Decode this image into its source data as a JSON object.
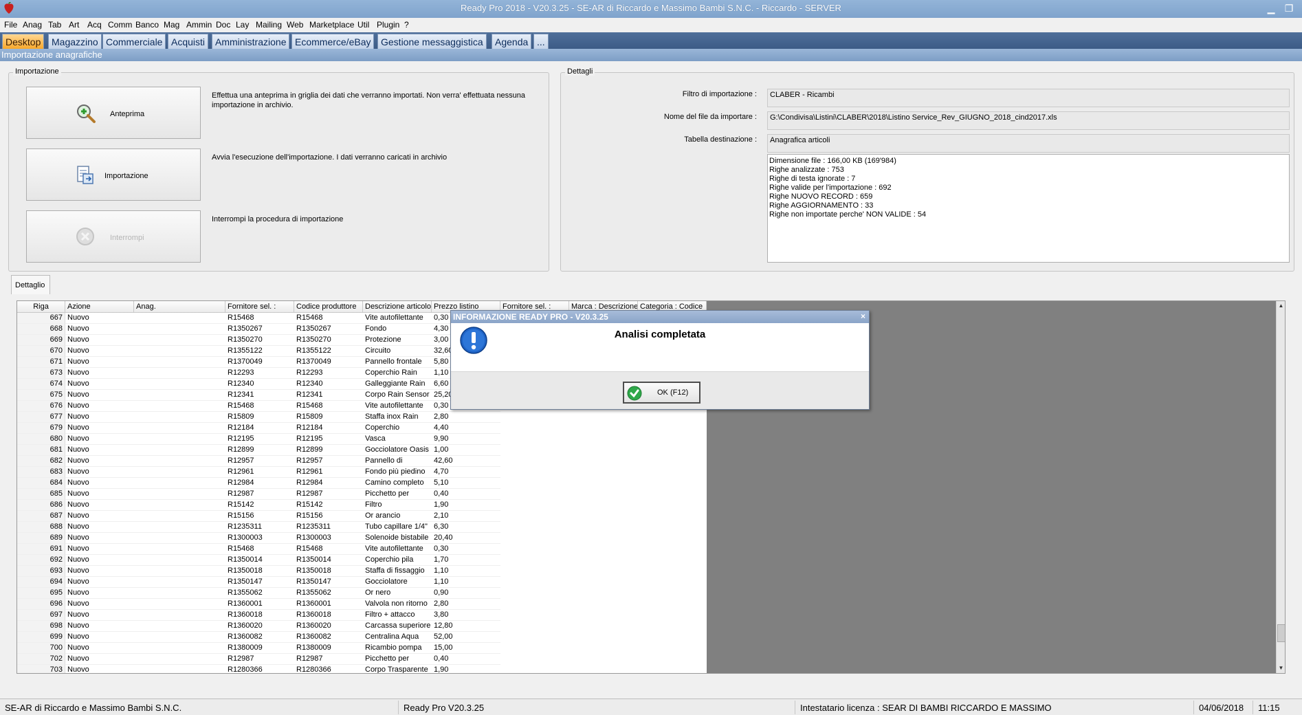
{
  "window": {
    "title": "Ready Pro 2018 - V20.3.25 - SE-AR di Riccardo e Massimo Bambi S.N.C. - Riccardo - SERVER"
  },
  "menu": [
    "File",
    "Anag",
    "Tab",
    "Art",
    "Acq",
    "Comm",
    "Banco",
    "Mag",
    "Ammin",
    "Doc",
    "Lay",
    "Mailing",
    "Web",
    "Marketplace",
    "Util",
    "Plugin",
    "?"
  ],
  "module_tabs": [
    "Desktop",
    "Magazzino",
    "Commerciale",
    "Acquisti",
    "Amministrazione",
    "Ecommerce/eBay",
    "Gestione messaggistica",
    "Agenda",
    "..."
  ],
  "section_header": "Importazione anagrafiche",
  "importazione": {
    "group_title": "Importazione",
    "anteprima_label": "Anteprima",
    "anteprima_desc": "Effettua una anteprima in griglia dei dati che verranno importati. Non verra' effettuata nessuna importazione in archivio.",
    "importazione_label": "Importazione",
    "importazione_desc": "Avvia l'esecuzione dell'importazione. I dati verranno caricati in archivio",
    "interrompi_label": "Interrompi",
    "interrompi_desc": "Interrompi la procedura di importazione"
  },
  "dettagli": {
    "group_title": "Dettagli",
    "filtro_label": "Filtro di importazione :",
    "filtro_value": "CLABER - Ricambi",
    "file_label": "Nome del file da importare :",
    "file_value": "G:\\Condivisa\\Listini\\CLABER\\2018\\Listino Service_Rev_GIUGNO_2018_cind2017.xls",
    "tabella_label": "Tabella destinazione :",
    "tabella_value": "Anagrafica articoli",
    "info_lines": [
      "Dimensione file : 166,00 KB (169'984)",
      "Righe analizzate : 753",
      "Righe di testa ignorate : 7",
      "Righe valide per l'importazione : 692",
      "Righe NUOVO RECORD : 659",
      "Righe AGGIORNAMENTO  : 33",
      "Righe non importate perche' NON VALIDE : 54"
    ]
  },
  "detail_tab": "Dettaglio",
  "grid": {
    "columns": [
      "Riga",
      "Azione",
      "Anag.",
      "Fornitore sel. :",
      "Codice produttore",
      "Descrizione articolo",
      "Prezzo listino",
      "Fornitore sel. :",
      "Marca : Descrizione",
      "Categoria : Codice"
    ],
    "rows": [
      [
        "667",
        "Nuovo",
        "",
        "R15468",
        "R15468",
        "Vite autofilettante",
        "0,30"
      ],
      [
        "668",
        "Nuovo",
        "",
        "R1350267",
        "R1350267",
        "Fondo",
        "4,30"
      ],
      [
        "669",
        "Nuovo",
        "",
        "R1350270",
        "R1350270",
        "Protezione",
        "3,00"
      ],
      [
        "670",
        "Nuovo",
        "",
        "R1355122",
        "R1355122",
        "Circuito",
        "32,60"
      ],
      [
        "671",
        "Nuovo",
        "",
        "R1370049",
        "R1370049",
        "Pannello frontale",
        "5,80"
      ],
      [
        "673",
        "Nuovo",
        "",
        "R12293",
        "R12293",
        "Coperchio Rain",
        "1,10"
      ],
      [
        "674",
        "Nuovo",
        "",
        "R12340",
        "R12340",
        "Galleggiante Rain",
        "6,60"
      ],
      [
        "675",
        "Nuovo",
        "",
        "R12341",
        "R12341",
        "Corpo Rain Sensor",
        "25,20"
      ],
      [
        "676",
        "Nuovo",
        "",
        "R15468",
        "R15468",
        "Vite autofilettante",
        "0,30"
      ],
      [
        "677",
        "Nuovo",
        "",
        "R15809",
        "R15809",
        "Staffa inox Rain",
        "2,80"
      ],
      [
        "679",
        "Nuovo",
        "",
        "R12184",
        "R12184",
        "Coperchio",
        "4,40"
      ],
      [
        "680",
        "Nuovo",
        "",
        "R12195",
        "R12195",
        "Vasca",
        "9,90"
      ],
      [
        "681",
        "Nuovo",
        "",
        "R12899",
        "R12899",
        "Gocciolatore Oasis",
        "1,00"
      ],
      [
        "682",
        "Nuovo",
        "",
        "R12957",
        "R12957",
        "Pannello di",
        "42,60"
      ],
      [
        "683",
        "Nuovo",
        "",
        "R12961",
        "R12961",
        "Fondo più piedino",
        "4,70"
      ],
      [
        "684",
        "Nuovo",
        "",
        "R12984",
        "R12984",
        "Camino completo",
        "5,10"
      ],
      [
        "685",
        "Nuovo",
        "",
        "R12987",
        "R12987",
        "Picchetto per",
        "0,40"
      ],
      [
        "686",
        "Nuovo",
        "",
        "R15142",
        "R15142",
        "Filtro",
        "1,90"
      ],
      [
        "687",
        "Nuovo",
        "",
        "R15156",
        "R15156",
        "Or arancio",
        "2,10"
      ],
      [
        "688",
        "Nuovo",
        "",
        "R1235311",
        "R1235311",
        "Tubo capillare 1/4\"",
        "6,30"
      ],
      [
        "689",
        "Nuovo",
        "",
        "R1300003",
        "R1300003",
        "Solenoide bistabile",
        "20,40"
      ],
      [
        "691",
        "Nuovo",
        "",
        "R15468",
        "R15468",
        "Vite autofilettante",
        "0,30"
      ],
      [
        "692",
        "Nuovo",
        "",
        "R1350014",
        "R1350014",
        "Coperchio pila",
        "1,70"
      ],
      [
        "693",
        "Nuovo",
        "",
        "R1350018",
        "R1350018",
        "Staffa di fissaggio",
        "1,10"
      ],
      [
        "694",
        "Nuovo",
        "",
        "R1350147",
        "R1350147",
        "Gocciolatore",
        "1,10"
      ],
      [
        "695",
        "Nuovo",
        "",
        "R1355062",
        "R1355062",
        "Or nero",
        "0,90"
      ],
      [
        "696",
        "Nuovo",
        "",
        "R1360001",
        "R1360001",
        "Valvola non ritorno",
        "2,80"
      ],
      [
        "697",
        "Nuovo",
        "",
        "R1360018",
        "R1360018",
        "Filtro + attacco",
        "3,80"
      ],
      [
        "698",
        "Nuovo",
        "",
        "R1360020",
        "R1360020",
        "Carcassa superiore",
        "12,80"
      ],
      [
        "699",
        "Nuovo",
        "",
        "R1360082",
        "R1360082",
        "Centralina Aqua",
        "52,00"
      ],
      [
        "700",
        "Nuovo",
        "",
        "R1380009",
        "R1380009",
        "Ricambio pompa",
        "15,00"
      ],
      [
        "702",
        "Nuovo",
        "",
        "R12987",
        "R12987",
        "Picchetto per",
        "0,40"
      ],
      [
        "703",
        "Nuovo",
        "",
        "R1280366",
        "R1280366",
        "Corpo Trasparente",
        "1,90"
      ]
    ]
  },
  "dialog": {
    "title": "INFORMAZIONE READY PRO - V20.3.25",
    "close": "×",
    "message": "Analisi completata",
    "ok_label": "OK (F12)"
  },
  "status": {
    "company": "SE-AR di Riccardo e Massimo Bambi S.N.C.",
    "version": "Ready Pro V20.3.25",
    "license": "Intestatario licenza : SEAR DI BAMBI RICCARDO E MASSIMO",
    "date": "04/06/2018",
    "time": "11:15"
  },
  "colors": {
    "accent": "#f8a82c",
    "titlebar": "#7fa3cc",
    "tabstrip": "#3c5b86"
  }
}
